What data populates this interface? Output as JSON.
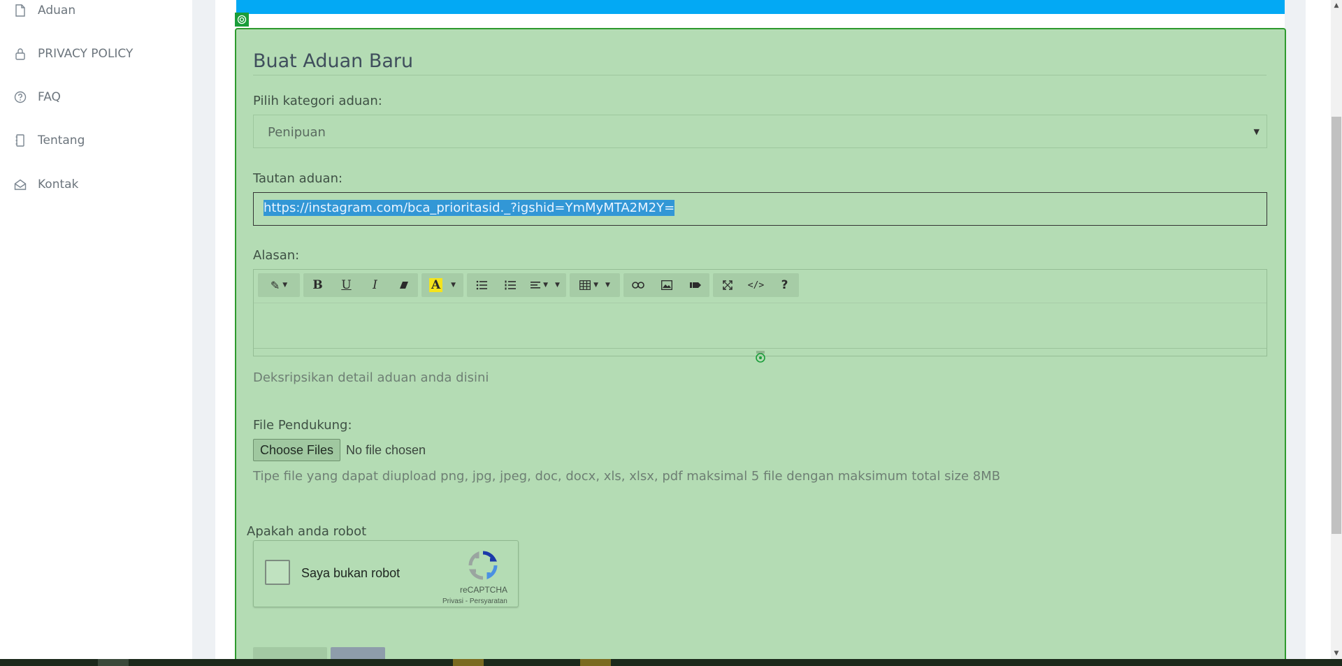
{
  "sidebar": {
    "items": [
      {
        "label": "Aduan",
        "icon": "file-icon"
      },
      {
        "label": "PRIVACY POLICY",
        "icon": "lock-icon"
      },
      {
        "label": "FAQ",
        "icon": "question-circle-icon"
      },
      {
        "label": "Tentang",
        "icon": "book-icon"
      },
      {
        "label": "Kontak",
        "icon": "envelope-open-icon"
      }
    ]
  },
  "form": {
    "title": "Buat Aduan Baru",
    "category_label": "Pilih kategori aduan:",
    "category_value": "Penipuan",
    "link_label": "Tautan aduan:",
    "link_value": "https://instagram.com/bca_prioritasid._?igshid=YmMyMTA2M2Y=",
    "reason_label": "Alasan:",
    "reason_hint": "Deksripsikan detail aduan anda disini",
    "file_label": "File Pendukung:",
    "file_button": "Choose Files",
    "file_status": "No file chosen",
    "file_hint": "Tipe file yang dapat diupload png, jpg, jpeg, doc, docx, xls, xlsx, pdf maksimal 5 file dengan maksimum total size 8MB",
    "robot_label": "Apakah anda robot"
  },
  "captcha": {
    "label": "Saya bukan robot",
    "brand": "reCAPTCHA",
    "links": "Privasi - Persyaratan"
  },
  "toolbar": {
    "buttons": [
      {
        "name": "magic-style-button",
        "glyph": "✎"
      },
      {
        "name": "bold-button",
        "glyph": "B"
      },
      {
        "name": "underline-button",
        "glyph": "U"
      },
      {
        "name": "italic-button",
        "glyph": "I"
      },
      {
        "name": "eraser-button",
        "glyph": "⌫"
      },
      {
        "name": "font-color-button",
        "glyph": "A"
      },
      {
        "name": "unordered-list-button",
        "glyph": "☰"
      },
      {
        "name": "ordered-list-button",
        "glyph": "≡"
      },
      {
        "name": "align-button",
        "glyph": "≡"
      },
      {
        "name": "table-button",
        "glyph": "▦"
      },
      {
        "name": "link-button",
        "glyph": "🔗"
      },
      {
        "name": "image-button",
        "glyph": "▣"
      },
      {
        "name": "video-button",
        "glyph": "▶"
      },
      {
        "name": "fullscreen-button",
        "glyph": "⛶"
      },
      {
        "name": "code-view-button",
        "glyph": "</>"
      },
      {
        "name": "help-button",
        "glyph": "?"
      }
    ]
  },
  "colors": {
    "panel_bg": "#b4dcb4",
    "panel_border": "#2e9a2e",
    "blue_bar": "#03a9f4",
    "selection": "#3297d6"
  }
}
